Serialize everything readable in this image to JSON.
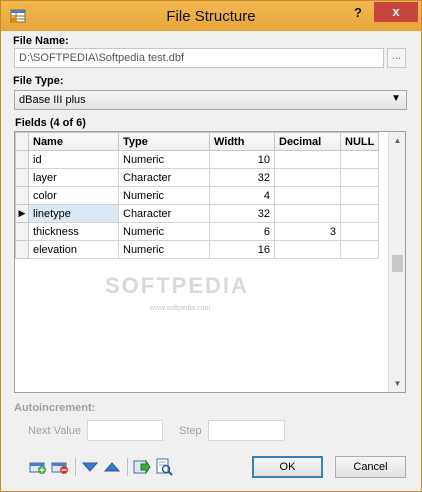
{
  "window": {
    "title": "File Structure",
    "help_label": "?",
    "close_label": "x"
  },
  "file_name": {
    "label": "File Name:",
    "value": "D:\\SOFTPEDIA\\Softpedia test.dbf",
    "browse_label": "..."
  },
  "file_type": {
    "label": "File Type:",
    "value": "dBase III plus"
  },
  "fields": {
    "label": "Fields (4 of 6)",
    "columns": [
      "Name",
      "Type",
      "Width",
      "Decimal",
      "NULL"
    ],
    "rows": [
      {
        "name": "id",
        "type": "Numeric",
        "width": "10",
        "decimal": "",
        "null": ""
      },
      {
        "name": "layer",
        "type": "Character",
        "width": "32",
        "decimal": "",
        "null": ""
      },
      {
        "name": "color",
        "type": "Numeric",
        "width": "4",
        "decimal": "",
        "null": ""
      },
      {
        "name": "linetype",
        "type": "Character",
        "width": "32",
        "decimal": "",
        "null": ""
      },
      {
        "name": "thickness",
        "type": "Numeric",
        "width": "6",
        "decimal": "3",
        "null": ""
      },
      {
        "name": "elevation",
        "type": "Numeric",
        "width": "16",
        "decimal": "",
        "null": ""
      }
    ],
    "current_row_marker": "▶",
    "watermark": "SOFTPEDIA",
    "watermark_url": "www.softpedia.com"
  },
  "autoincrement": {
    "label": "Autoincrement:",
    "next_value_label": "Next Value",
    "next_value": "",
    "step_label": "Step",
    "step": ""
  },
  "toolbar": {
    "icons": [
      "add-field-icon",
      "delete-field-icon",
      "move-down-icon",
      "move-up-icon",
      "export-icon",
      "preview-icon"
    ]
  },
  "buttons": {
    "ok": "OK",
    "cancel": "Cancel"
  },
  "colors": {
    "title_bar": "#e9a53a",
    "close_button": "#c7453a",
    "selection": "#dbe9f7"
  }
}
